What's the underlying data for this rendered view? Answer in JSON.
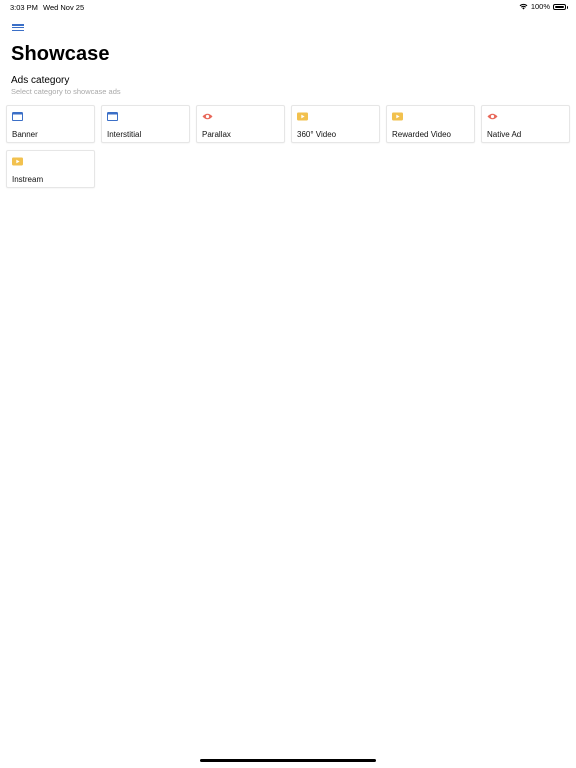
{
  "status_bar": {
    "time": "3:03 PM",
    "date": "Wed Nov 25",
    "battery": "100%",
    "icons": [
      "wifi-icon",
      "battery-icon"
    ]
  },
  "header": {
    "menu_icon": "hamburger-menu-icon",
    "title": "Showcase"
  },
  "section": {
    "title": "Ads category",
    "subtitle": "Select category to showcase ads"
  },
  "colors": {
    "accent_blue": "#3b6fc7",
    "eye_red": "#e8685a",
    "video_yellow": "#f2c14e",
    "subtitle_gray": "#a9a9a9",
    "card_border": "#e6e6e6"
  },
  "categories": [
    {
      "label": "Banner",
      "icon": "window-icon"
    },
    {
      "label": "Interstitial",
      "icon": "window-icon"
    },
    {
      "label": "Parallax",
      "icon": "eye-icon"
    },
    {
      "label": "360° Video",
      "icon": "video-play-icon"
    },
    {
      "label": "Rewarded Video",
      "icon": "video-play-icon"
    },
    {
      "label": "Native Ad",
      "icon": "eye-icon"
    },
    {
      "label": "Instream",
      "icon": "video-play-icon"
    }
  ]
}
